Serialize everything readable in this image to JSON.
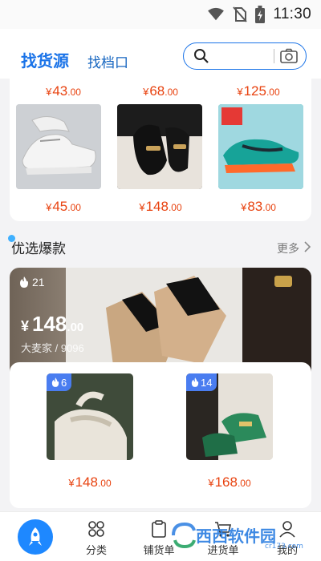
{
  "status_bar": {
    "time": "11:30"
  },
  "header": {
    "tab_active": "找货源",
    "tab_other": "找档口",
    "search_placeholder": ""
  },
  "top_grid": {
    "prev_row_prices": [
      {
        "currency": "¥",
        "int": "43",
        "dec": ".00"
      },
      {
        "currency": "¥",
        "int": "68",
        "dec": ".00"
      },
      {
        "currency": "¥",
        "int": "125",
        "dec": ".00"
      }
    ],
    "items": [
      {
        "image": "white-sneaker-photo",
        "currency": "¥",
        "int": "45",
        "dec": ".00"
      },
      {
        "image": "black-loafer-photo",
        "currency": "¥",
        "int": "148",
        "dec": ".00"
      },
      {
        "image": "teal-running-shoe-photo",
        "currency": "¥",
        "int": "83",
        "dec": ".00"
      }
    ]
  },
  "section": {
    "title": "优选爆款",
    "more_label": "更多"
  },
  "featured": {
    "hot_count": "21",
    "currency": "¥",
    "price_int": "148",
    "price_dec": ".00",
    "shop": "大麦家 / 9096",
    "sub_items": [
      {
        "hot_count": "6",
        "currency": "¥",
        "int": "148",
        "dec": ".00"
      },
      {
        "hot_count": "14",
        "currency": "¥",
        "int": "168",
        "dec": ".00"
      }
    ]
  },
  "tab_bar": {
    "items": [
      {
        "label": "分类"
      },
      {
        "label": "铺货单"
      },
      {
        "label": "进货单"
      },
      {
        "label": "我的"
      }
    ]
  },
  "watermark": {
    "text": "西西软件园",
    "sub": "cr173.com"
  },
  "colors": {
    "accent": "#1a73e8",
    "price": "#e8420f"
  }
}
